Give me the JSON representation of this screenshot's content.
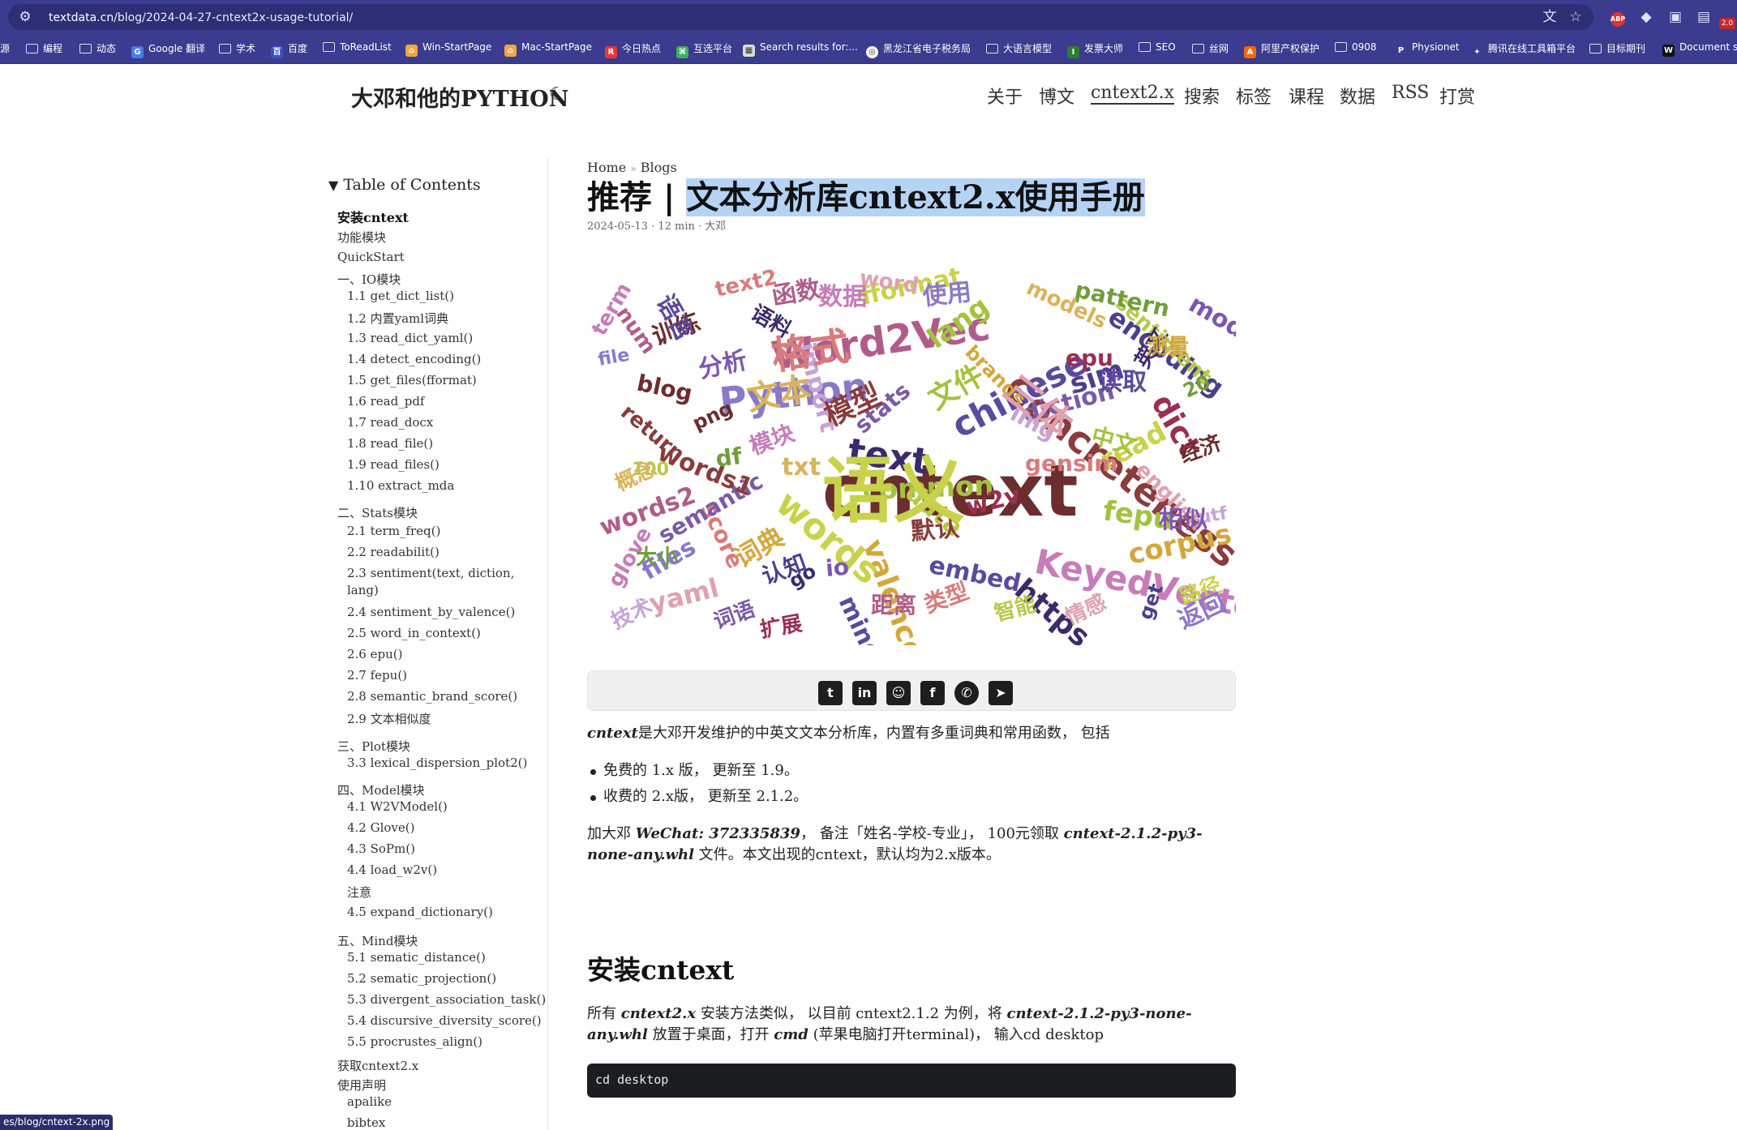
{
  "browser": {
    "url_domain": "textdata.cn",
    "url_path": "/blog/2024-04-27-cntext2x-usage-tutorial/",
    "bookmarks": [
      "源",
      "编程",
      "动态",
      "Google 翻译",
      "学术",
      "百度",
      "ToReadList",
      "Win-StartPage",
      "Mac-StartPage",
      "今日热点",
      "互选平台",
      "Search results for:...",
      "黑龙江省电子税务局",
      "大语言模型",
      "发票大师",
      "SEO",
      "丝网",
      "阿里产权保护",
      "0908",
      "Physionet",
      "腾讯在线工具箱平台",
      "目标期刊",
      "Document si"
    ],
    "ext_badge": "2.0",
    "status_url": "es/blog/cntext-2x.png"
  },
  "site": {
    "title": "大邓和他的PYTHON",
    "nav": [
      "关于",
      "博文",
      "cntext2.x",
      "搜索",
      "标签",
      "课程",
      "数据",
      "RSS",
      "打赏"
    ],
    "nav_active": "cntext2.x"
  },
  "toc": {
    "title": "Table of Contents",
    "items": [
      "安装cntext",
      "功能模块",
      "QuickStart",
      "一、IO模块",
      "1.1 get_dict_list()",
      "1.2 内置yaml词典",
      "1.3 read_dict_yaml()",
      "1.4 detect_encoding()",
      "1.5 get_files(fformat)",
      "1.6 read_pdf",
      "1.7 read_docx",
      "1.8 read_file()",
      "1.9 read_files()",
      "1.10 extract_mda",
      "二、Stats模块",
      "2.1 term_freq()",
      "2.2 readabilit()",
      "2.3 sentiment(text, diction,",
      "lang)",
      "2.4 sentiment_by_valence()",
      "2.5 word_in_context()",
      "2.6 epu()",
      "2.7 fepu()",
      "2.8 semantic_brand_score()",
      "2.9 文本相似度",
      "三、Plot模块",
      "3.3 lexical_dispersion_plot2()",
      "四、Model模块",
      "4.1 W2VModel()",
      "4.2 Glove()",
      "4.3 SoPm()",
      "4.4 load_w2v()",
      "注意",
      "4.5 expand_dictionary()",
      "五、Mind模块",
      "5.1 sematic_distance()",
      "5.2 sematic_projection()",
      "5.3 divergent_association_task()",
      "5.4 discursive_diversity_score()",
      "5.5 procrustes_align()",
      "获取cntext2.x",
      "使用声明",
      "apalike",
      "bibtex"
    ]
  },
  "post": {
    "breadcrumb_home": "Home",
    "breadcrumb_sep": "»",
    "breadcrumb_blogs": "Blogs",
    "title_prefix": "推荐 | ",
    "title_selected": "文本分析库cntext2.x使用手册",
    "meta": "2024-05-13 · 12 min · 大邓",
    "intro_name": "cntext",
    "intro_rest": "是大邓开发维护的中英文文本分析库，内置有多重词典和常用函数， 包括",
    "bullets": [
      "免费的 1.x 版， 更新至 1.9。",
      "收费的 2.x版， 更新至 2.1.2。"
    ],
    "p2_a": "加大邓 ",
    "p2_wechat": "WeChat: 372335839",
    "p2_b": "， 备注「姓名-学校-专业」， 100元领取 ",
    "p2_file": "cntext-2.1.2-py3-none-any.whl",
    "p2_c": " 文件。本文出现的cntext，默认均为2.x版本。",
    "install_heading": "安装cntext",
    "p3_a": "所有 ",
    "p3_cn": "cntext2.x",
    "p3_b": " 安装方法类似， 以目前 cntext2.1.2 为例，将 ",
    "p3_file": "cntext-2.1.2-py3-none-any.whl",
    "p3_c": " 放置于桌面，打开 ",
    "p3_cmd": "cmd",
    "p3_d": " (苹果电脑打开terminal)， 输入cd desktop",
    "code": "cd desktop"
  },
  "share_icons": [
    "twitter-icon",
    "linkedin-icon",
    "reddit-icon",
    "facebook-icon",
    "whatsapp-icon",
    "telegram-icon"
  ],
  "wordcloud_words": [
    "cntext",
    "Concreteness",
    "Word2Vec",
    "KeyedVectors",
    "Python",
    "chinese",
    "text",
    "common",
    "valence",
    "words",
    "yaml",
    "score",
    "semantic",
    "import",
    "encoding",
    "dict",
    "sentiment",
    "pattern",
    "models",
    "model",
    "blog",
    "words1",
    "words2",
    "glove",
    "files",
    "embed",
    "https",
    "fepu",
    "corpus",
    "read",
    "english",
    "gensim",
    "diction",
    "img",
    "sim",
    "w2v",
    "data",
    "df",
    "txt",
    "io",
    "png",
    "return",
    "num",
    "term",
    "file",
    "mind",
    "go",
    "lang",
    "brands",
    "fformat",
    "word",
    "text2",
    "stats",
    "utf",
    "get",
    "epu",
    "100",
    "20",
    "文本",
    "分析",
    "训练",
    "模型",
    "函数",
    "数据",
    "使用",
    "语言",
    "语料",
    "文件",
    "词典",
    "路径",
    "情感",
    "类型",
    "词语",
    "技术",
    "认知",
    "扩展",
    "智能",
    "大小",
    "概念",
    "相似",
    "经济",
    "默认",
    "距离",
    "模块",
    "返回",
    "读取",
    "英文",
    "中文",
    "测量",
    "语义",
    "三体",
    "格式"
  ]
}
